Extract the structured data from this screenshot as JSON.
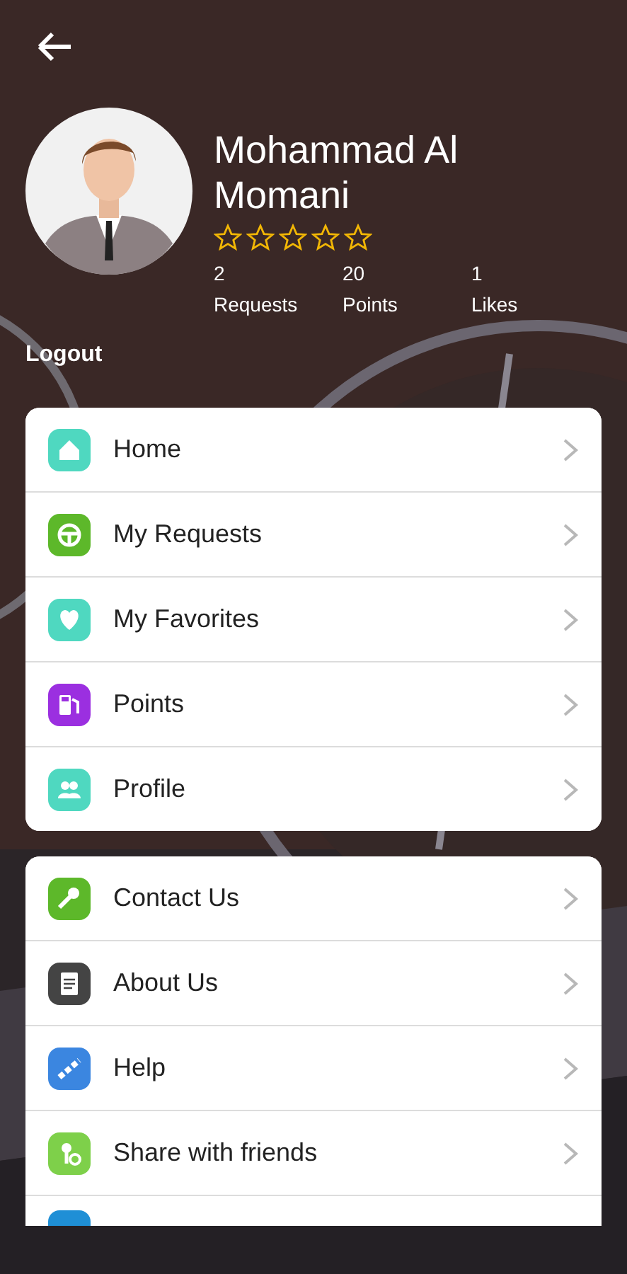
{
  "profile": {
    "name": "Mohammad Al Momani",
    "stars": 0,
    "stats": [
      {
        "value": "2",
        "label": "Requests"
      },
      {
        "value": "20",
        "label": "Points"
      },
      {
        "value": "1",
        "label": "Likes"
      }
    ],
    "logout": "Logout"
  },
  "menus": [
    {
      "items": [
        {
          "label": "Home"
        },
        {
          "label": "My Requests"
        },
        {
          "label": "My Favorites"
        },
        {
          "label": "Points"
        },
        {
          "label": "Profile"
        }
      ],
      "more_below": false
    },
    {
      "items": [
        {
          "label": "Contact Us"
        },
        {
          "label": "About Us"
        },
        {
          "label": "Help"
        },
        {
          "label": "Share with friends"
        }
      ],
      "more_below": true
    }
  ]
}
